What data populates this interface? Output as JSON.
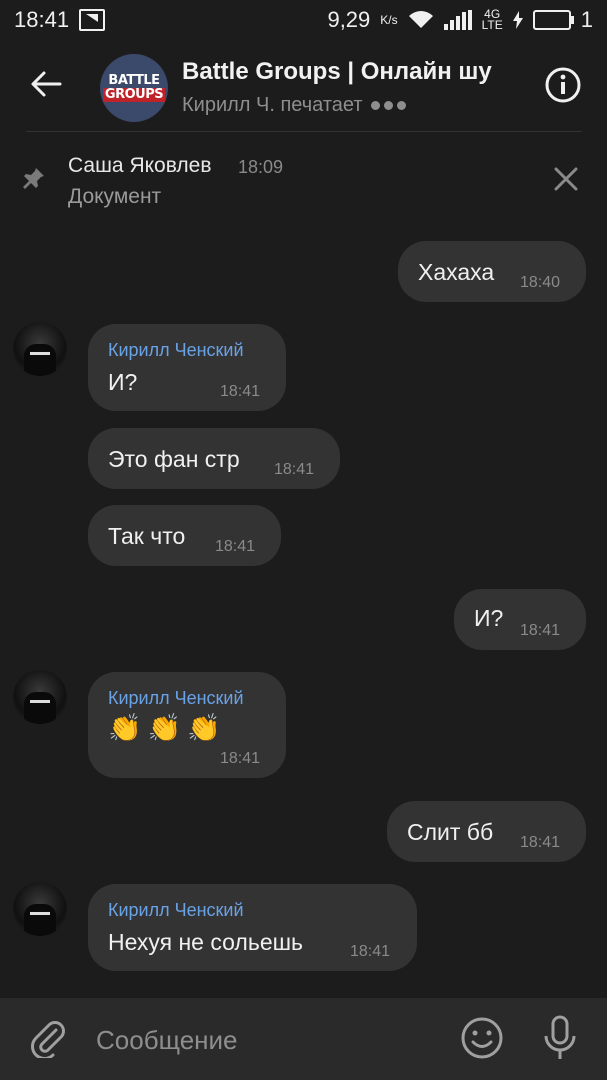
{
  "status_bar": {
    "time": "18:41",
    "net_speed": "9,29",
    "net_unit": "K/s",
    "network": "4G",
    "network_sub": "LTE",
    "battery_level": "1"
  },
  "header": {
    "title": "Battle Groups | Онлайн шу",
    "typing_status": "Кирилл Ч. печатает",
    "logo_line1": "BATTLE",
    "logo_line2": "GROUPS"
  },
  "pinned": {
    "author": "Саша Яковлев",
    "time": "18:09",
    "text": "Документ"
  },
  "messages": [
    {
      "side": "out",
      "text": "Хахаха",
      "time": "18:40"
    },
    {
      "side": "in",
      "author": "Кирилл Ченский",
      "text": "И?",
      "time": "18:41"
    },
    {
      "side": "in",
      "text": "Это фан стр",
      "time": "18:41"
    },
    {
      "side": "in",
      "text": "Так что",
      "time": "18:41"
    },
    {
      "side": "out",
      "text": "И?",
      "time": "18:41"
    },
    {
      "side": "in",
      "author": "Кирилл Ченский",
      "text": "👏👏👏",
      "time": "18:41"
    },
    {
      "side": "out",
      "text": "Слит бб",
      "time": "18:41"
    },
    {
      "side": "in",
      "author": "Кирилл Ченский",
      "text": "Нехуя не сольешь",
      "time": "18:41"
    }
  ],
  "composer": {
    "placeholder": "Сообщение"
  },
  "colors": {
    "background": "#1c1c1c",
    "bubble": "#333333",
    "author_name": "#6aa2e6",
    "input_bar": "#2a2a2a"
  },
  "icons": [
    "back-arrow-icon",
    "info-icon",
    "pin-icon",
    "close-icon",
    "attach-icon",
    "emoji-icon",
    "mic-icon",
    "wifi-icon",
    "signal-icon",
    "battery-icon"
  ]
}
